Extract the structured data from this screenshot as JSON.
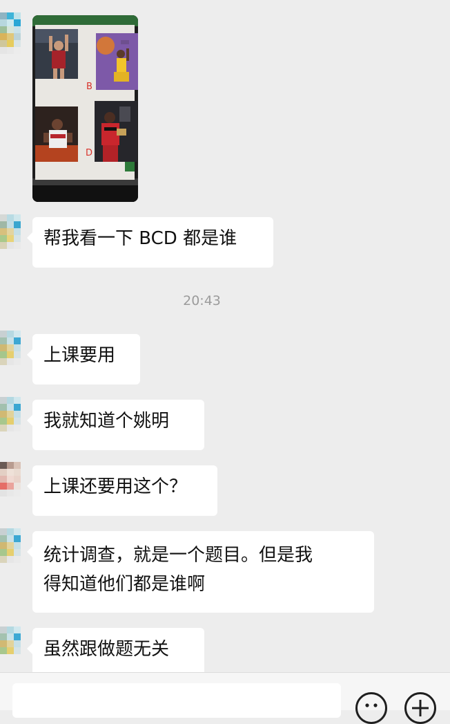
{
  "chat": {
    "image_labels": [
      "B",
      "D"
    ],
    "messages": [
      {
        "text": "帮我看一下 BCD 都是谁"
      },
      {
        "text": "上课要用"
      },
      {
        "text": "我就知道个姚明"
      },
      {
        "text": "上课还要用这个？"
      },
      {
        "text": "统计调查，就是一个题目。但是我\n得知道他们都是谁啊"
      },
      {
        "text": "虽然跟做题无关"
      }
    ],
    "timestamp": "20:43"
  },
  "input_bar": {
    "emoji_icon": "emoji-icon",
    "plus_icon": "plus-icon"
  },
  "colors": {
    "background": "#ededed",
    "bubble": "#ffffff",
    "timestamp": "#9b9b9b",
    "label_red": "#d8312a"
  }
}
